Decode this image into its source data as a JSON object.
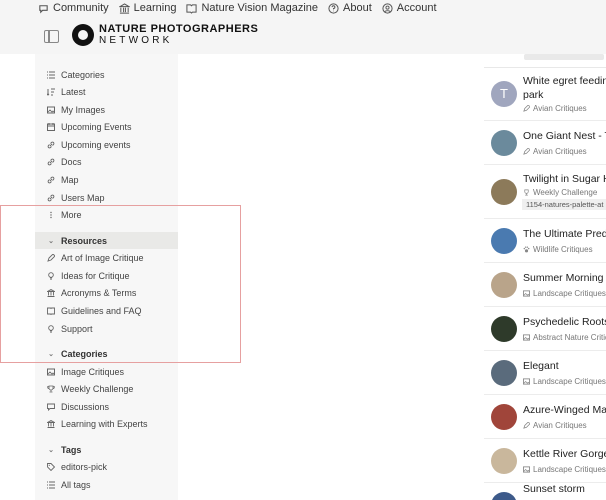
{
  "topnav": [
    {
      "label": "Community",
      "icon": "chat-icon"
    },
    {
      "label": "Learning",
      "icon": "bank-icon"
    },
    {
      "label": "Nature Vision Magazine",
      "icon": "book-icon"
    },
    {
      "label": "About",
      "icon": "question-circle-icon"
    },
    {
      "label": "Account",
      "icon": "user-circle-icon"
    }
  ],
  "logo": {
    "line1": "NATURE PHOTOGRAPHERS",
    "line2": "NETWORK"
  },
  "sidebar": {
    "items": [
      {
        "label": "Categories",
        "icon": "list-icon"
      },
      {
        "label": "Latest",
        "icon": "sort-icon"
      },
      {
        "label": "My Images",
        "icon": "image-icon"
      },
      {
        "label": "Upcoming Events",
        "icon": "calendar-icon"
      },
      {
        "label": "Upcoming events",
        "icon": "link-icon"
      },
      {
        "label": "Docs",
        "icon": "link-icon"
      },
      {
        "label": "Map",
        "icon": "link-icon"
      },
      {
        "label": "Users Map",
        "icon": "link-icon"
      },
      {
        "label": "More",
        "icon": "ellipsis-icon"
      }
    ],
    "resources": {
      "header": "Resources",
      "items": [
        {
          "label": "Art of Image Critique",
          "icon": "pen-icon"
        },
        {
          "label": "Ideas for Critique",
          "icon": "lightbulb-icon"
        },
        {
          "label": "Acronyms & Terms",
          "icon": "bank-icon"
        },
        {
          "label": "Guidelines and FAQ",
          "icon": "book-icon"
        },
        {
          "label": "Support",
          "icon": "support-icon"
        }
      ]
    },
    "categories": {
      "header": "Categories",
      "items": [
        {
          "label": "Image Critiques",
          "icon": "image-icon"
        },
        {
          "label": "Weekly Challenge",
          "icon": "trophy-icon"
        },
        {
          "label": "Discussions",
          "icon": "chat-icon"
        },
        {
          "label": "Learning with Experts",
          "icon": "bank-icon"
        }
      ]
    },
    "tags": {
      "header": "Tags",
      "items": [
        {
          "label": "editors-pick",
          "icon": "tag-icon"
        },
        {
          "label": "All tags",
          "icon": "list-icon"
        }
      ]
    }
  },
  "topics": [
    {
      "title": "White egret feeding park",
      "title_line1": "White egret feeding",
      "title_line2": "park",
      "category": "Avian Critiques",
      "avatar_letter": "T"
    },
    {
      "title_line1": "One Giant Nest - Tw",
      "category": "Avian Critiques"
    },
    {
      "title_line1": "Twilight in Sugar Hil",
      "category": "Weekly Challenge",
      "tag": "1154-natures-palette-at"
    },
    {
      "title_line1": "The Ultimate Preda",
      "category": "Wildlife Critiques"
    },
    {
      "title_line1": "Summer Morning at",
      "category": "Landscape Critiques"
    },
    {
      "title_line1": "Psychedelic Roots A",
      "category": "Abstract Nature Critiq"
    },
    {
      "title_line1": "Elegant",
      "category": "Landscape Critiques"
    },
    {
      "title_line1": "Azure-Winged Mag",
      "category": "Avian Critiques"
    },
    {
      "title_line1": "Kettle River Gorge",
      "category": "Landscape Critiques"
    },
    {
      "title_line1": "Sunset storm",
      "category": ""
    }
  ],
  "colors": {
    "avatar_letter_bg": "#a0a6be",
    "highlight_border": "#e6a0a0"
  }
}
